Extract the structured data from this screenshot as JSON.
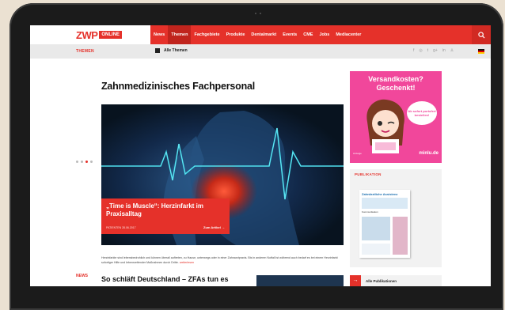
{
  "header": {
    "logo_text": "ZWP",
    "logo_badge": "ONLINE",
    "nav": [
      "News",
      "Themen",
      "Fachgebiete",
      "Produkte",
      "Dentalmarkt",
      "Events",
      "CME",
      "Jobs",
      "Mediacenter"
    ],
    "active_nav": "Themen"
  },
  "subbar": {
    "section_label": "THEMEN",
    "all_themes": "Alle Themen",
    "social_icons": [
      "facebook-icon",
      "instagram-icon",
      "twitter-icon",
      "google-plus-icon",
      "linkedin-icon",
      "user-icon"
    ]
  },
  "main": {
    "title": "Zahnmedizinisches Fachpersonal",
    "hero": {
      "headline": "„Time is Muscle“: Herzinfarkt im Praxisalltag",
      "meta": "PATIENTEN 28.06.2017",
      "link": "Zum Artikel",
      "active_dot": 3,
      "dot_count": 4
    },
    "teaser": "Herzinfarkte sind lebensbedrohlich und können überall auftreten, zu Hause, unterwegs oder in einer Zahnarztpraxis. Bis in anderen Notfall ist während auch bedarf es bei einem Herzinfarkt sofortiger Hilfe und lebensrettender Maßnahmen durch Dritte.",
    "teaser_more": "weiterlesen",
    "news_label": "NEWS",
    "news_title": "So schläft Deutschland – ZFAs tun es"
  },
  "ad": {
    "headline_1": "Versandkosten?",
    "headline_2": "Geschenkt!",
    "bubble": "Ab sofort portofrei bestellen!",
    "footer": "Anzeige",
    "brand": "minlu.de",
    "bg_color": "#f1479b"
  },
  "publication": {
    "label": "PUBLIKATION",
    "magazine_title": "Zahnärztliche Assistenz",
    "magazine_headline": "Kommunikation",
    "all_label": "Alle Publikationen"
  },
  "colors": {
    "accent": "#e5312a",
    "nav_active": "#c0241d"
  }
}
